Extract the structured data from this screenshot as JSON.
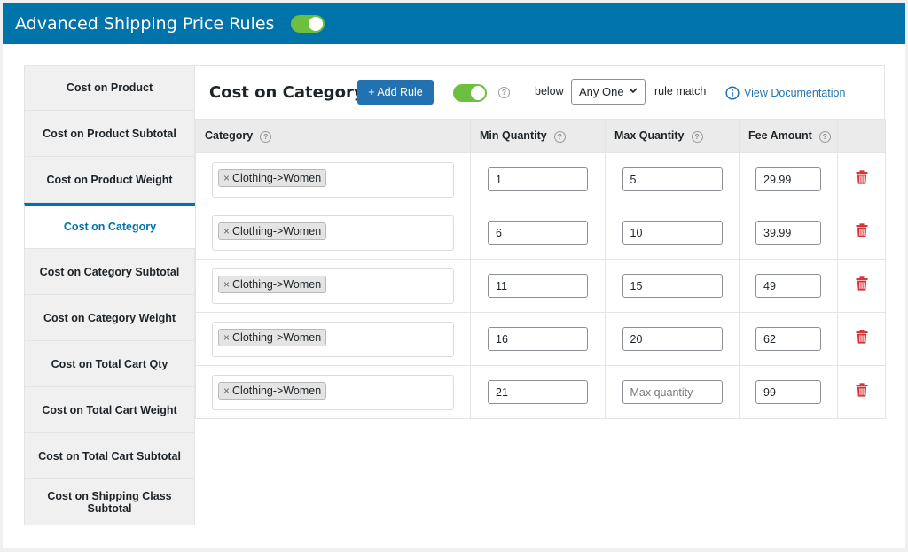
{
  "topbar": {
    "title": "Advanced Shipping Price Rules",
    "enabled": true
  },
  "sidebar": {
    "items": [
      {
        "label": "Cost on Product",
        "active": false
      },
      {
        "label": "Cost on Product Subtotal",
        "active": false
      },
      {
        "label": "Cost on Product Weight",
        "active": false
      },
      {
        "label": "Cost on Category",
        "active": true
      },
      {
        "label": "Cost on Category Subtotal",
        "active": false
      },
      {
        "label": "Cost on Category Weight",
        "active": false
      },
      {
        "label": "Cost on Total Cart Qty",
        "active": false
      },
      {
        "label": "Cost on Total Cart Weight",
        "active": false
      },
      {
        "label": "Cost on Total Cart Subtotal",
        "active": false
      },
      {
        "label": "Cost on Shipping Class Subtotal",
        "active": false
      }
    ]
  },
  "header": {
    "heading": "Cost on Category",
    "add_rule_label": "+ Add Rule",
    "below_label": "below",
    "match_select": "Any One",
    "rule_match_label": "rule match",
    "doc_link_label": "View Documentation"
  },
  "table": {
    "columns": {
      "category": "Category",
      "min_qty": "Min Quantity",
      "max_qty": "Max Quantity",
      "fee": "Fee Amount"
    },
    "rows": [
      {
        "category": "Clothing->Women",
        "min": "1",
        "max": "5",
        "fee": "29.99"
      },
      {
        "category": "Clothing->Women",
        "min": "6",
        "max": "10",
        "fee": "39.99"
      },
      {
        "category": "Clothing->Women",
        "min": "11",
        "max": "15",
        "fee": "49"
      },
      {
        "category": "Clothing->Women",
        "min": "16",
        "max": "20",
        "fee": "62"
      },
      {
        "category": "Clothing->Women",
        "min": "21",
        "max": "",
        "fee": "99"
      }
    ],
    "max_placeholder": "Max quantity",
    "help_glyph": "?",
    "remove_glyph": "×"
  },
  "colors": {
    "brand": "#0073aa",
    "toggle_on": "#6cbf3f",
    "button": "#2271b1",
    "delete": "#d63638"
  }
}
